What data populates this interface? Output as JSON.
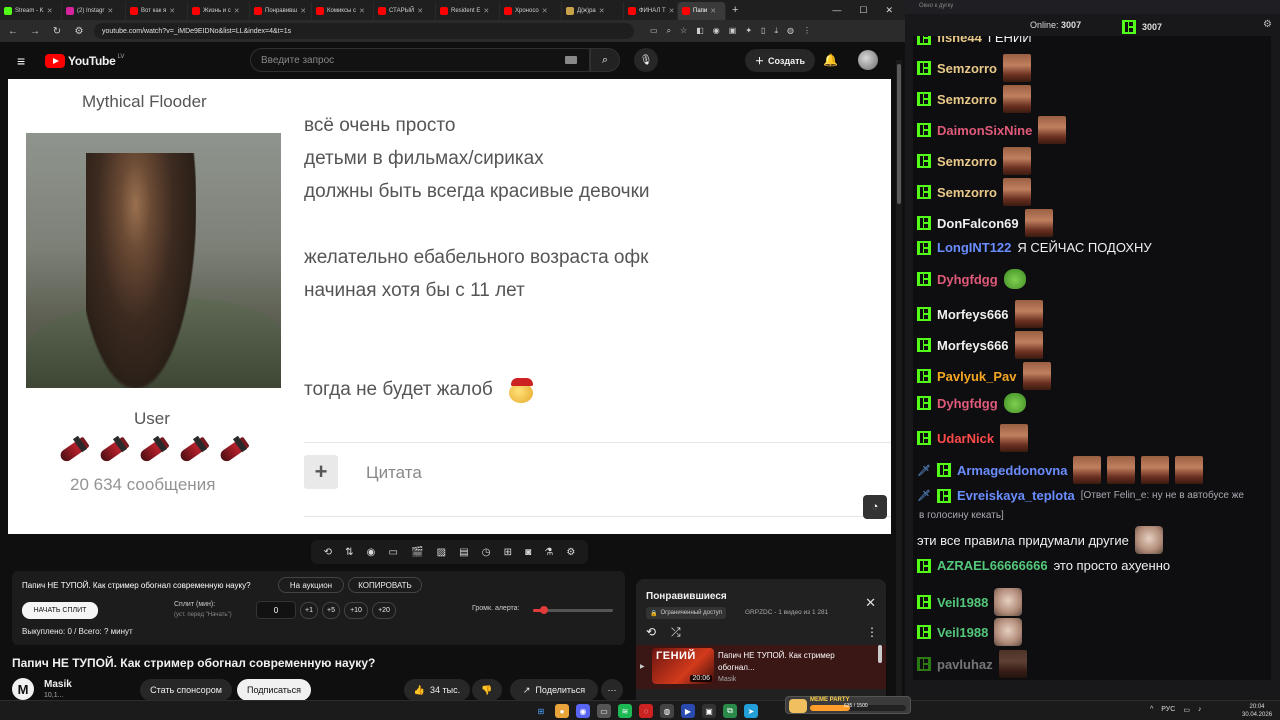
{
  "browser": {
    "tabs": [
      {
        "label": "Stream - K",
        "fav": "#53fc18"
      },
      {
        "label": "(2) Instagr",
        "fav": "#d6249f"
      },
      {
        "label": "Вот как я",
        "fav": "#ff0000"
      },
      {
        "label": "Жизнь и с",
        "fav": "#ff0000"
      },
      {
        "label": "Понравивш",
        "fav": "#ff0000"
      },
      {
        "label": "Комиксы с",
        "fav": "#ff0000"
      },
      {
        "label": "СТАРЫЙ",
        "fav": "#ff0000"
      },
      {
        "label": "Resident E",
        "fav": "#ff0000"
      },
      {
        "label": "Хроносо",
        "fav": "#ff0000"
      },
      {
        "label": "Д(ж)ра",
        "fav": "#c8a24a"
      },
      {
        "label": "ФИНАЛ Т",
        "fav": "#ff0000"
      },
      {
        "label": "Папи",
        "fav": "#ff0000",
        "active": true
      }
    ],
    "url": "youtube.com/watch?v=_iMDe9EIDNo&list=LL&index=4&t=1s"
  },
  "youtube": {
    "logo_text": "YouTube",
    "region": "LV",
    "search_placeholder": "Введите запрос",
    "create_label": "Создать"
  },
  "video_frame": {
    "poster_name": "Mythical Flooder",
    "poster_role": "User",
    "poster_count": "20 634 сообщения",
    "post_lines": [
      "всё очень просто",
      "детьми в фильмах/сириках",
      "должны быть всегда красивые девочки",
      "",
      "желательно ебабельного возраста офк",
      "начиная хотя бы с 11 лет",
      "",
      "",
      "тогда не будет жалоб"
    ],
    "quote_label": "Цитата"
  },
  "split_panel": {
    "title": "Папич НЕ ТУПОЙ. Как стример обогнал современную науку?",
    "auction_label": "На аукцион",
    "copy_label": "КОПИРОВАТЬ",
    "start_label": "НАЧАТЬ СПЛИТ",
    "split_min_label": "Сплит (мин):",
    "split_sub_label": "(уст. перед \"Начать\")",
    "split_value": "0",
    "steps": [
      "+1",
      "+5",
      "+10",
      "+20"
    ],
    "alert_label": "Громк. алерта:",
    "alert_volume": 0.14,
    "paid_label": "Выкуплено: 0 / Всего: ? минут"
  },
  "video_info": {
    "title": "Папич НЕ ТУПОЙ. Как стример обогнал современную науку?",
    "channel_initial": "M",
    "channel_name": "Masik",
    "channel_subs": "10,1...",
    "sponsor_label": "Стать спонсором",
    "subscribe_label": "Подписаться",
    "likes": "34 тыс.",
    "share_label": "Поделиться"
  },
  "playlist": {
    "title": "Понравившиеся",
    "access": "Ограниченный доступ",
    "meta": "GRPZDC - 1 видео из 1 281",
    "item": {
      "thumb_caption": "ГЕНИЙ",
      "duration": "20:06",
      "title": "Папич НЕ ТУПОЙ. Как стример обогнал...",
      "channel": "Masik"
    }
  },
  "chat": {
    "window_title": "Окно к дугку",
    "online_label": "Online:",
    "online_count": "3007",
    "kick_count": "3007",
    "messages": [
      {
        "user": "fishe44",
        "color": "#e9c989",
        "text": "ГЕНИЙ",
        "emote": "none",
        "cut": true
      },
      {
        "user": "Semzorro",
        "color": "#e9c989",
        "text": "",
        "emote": "face"
      },
      {
        "user": "Semzorro",
        "color": "#e9c989",
        "text": "",
        "emote": "face"
      },
      {
        "user": "DaimonSixNine",
        "color": "#e05a7a",
        "text": "",
        "emote": "face"
      },
      {
        "user": "Semzorro",
        "color": "#e9c989",
        "text": "",
        "emote": "face"
      },
      {
        "user": "Semzorro",
        "color": "#e9c989",
        "text": "",
        "emote": "face"
      },
      {
        "user": "DonFalcon69",
        "color": "#f0f0f0",
        "text": "",
        "emote": "face"
      },
      {
        "user": "LongINT122",
        "color": "#6a8dff",
        "text": "Я СЕЙЧАС ПОДОХНУ",
        "emote": "none"
      },
      {
        "user": "Dyhgfdgg",
        "color": "#e05a7a",
        "text": "",
        "emote": "frog"
      },
      {
        "user": "Morfeys666",
        "color": "#f0f0f0",
        "text": "",
        "emote": "face"
      },
      {
        "user": "Morfeys666",
        "color": "#f0f0f0",
        "text": "",
        "emote": "face"
      },
      {
        "user": "Pavlyuk_Pav",
        "color": "#f5a623",
        "text": "",
        "emote": "face"
      },
      {
        "user": "Dyhgfdgg",
        "color": "#e05a7a",
        "text": "",
        "emote": "pepe"
      },
      {
        "user": "UdarNick",
        "color": "#ff4a4a",
        "text": "",
        "emote": "face"
      },
      {
        "user": "Armageddonovna",
        "color": "#6a8dff",
        "text": "",
        "emote": "face4",
        "sword": true
      },
      {
        "user": "Evreiskaya_teplota",
        "color": "#6a8dff",
        "text": "[Ответ Felin_e: ну не в автобусе же",
        "text2": "в голосину кекать]",
        "emote": "none",
        "sword": true
      },
      {
        "user": "",
        "color": "#efeff1",
        "text": "эти все правила придумали другие",
        "emote": "man"
      },
      {
        "user": "AZRAEL66666666",
        "color": "#53c77a",
        "text": "это просто ахуенно",
        "emote": "none"
      },
      {
        "user": "Veil1988",
        "color": "#53c77a",
        "text": "",
        "emote": "man"
      },
      {
        "user": "Veil1988",
        "color": "#53c77a",
        "text": "",
        "emote": "man"
      },
      {
        "user": "pavluhaz",
        "color": "#f0f0f0",
        "text": "",
        "emote": "face",
        "fade": true
      }
    ]
  },
  "taskbar": {
    "meme_label": "MEME PARTY",
    "meme_value": "635 / 1500",
    "meme_progress": 0.42,
    "lang": "РУС",
    "time": "20:04",
    "date": "30.04.2026"
  }
}
